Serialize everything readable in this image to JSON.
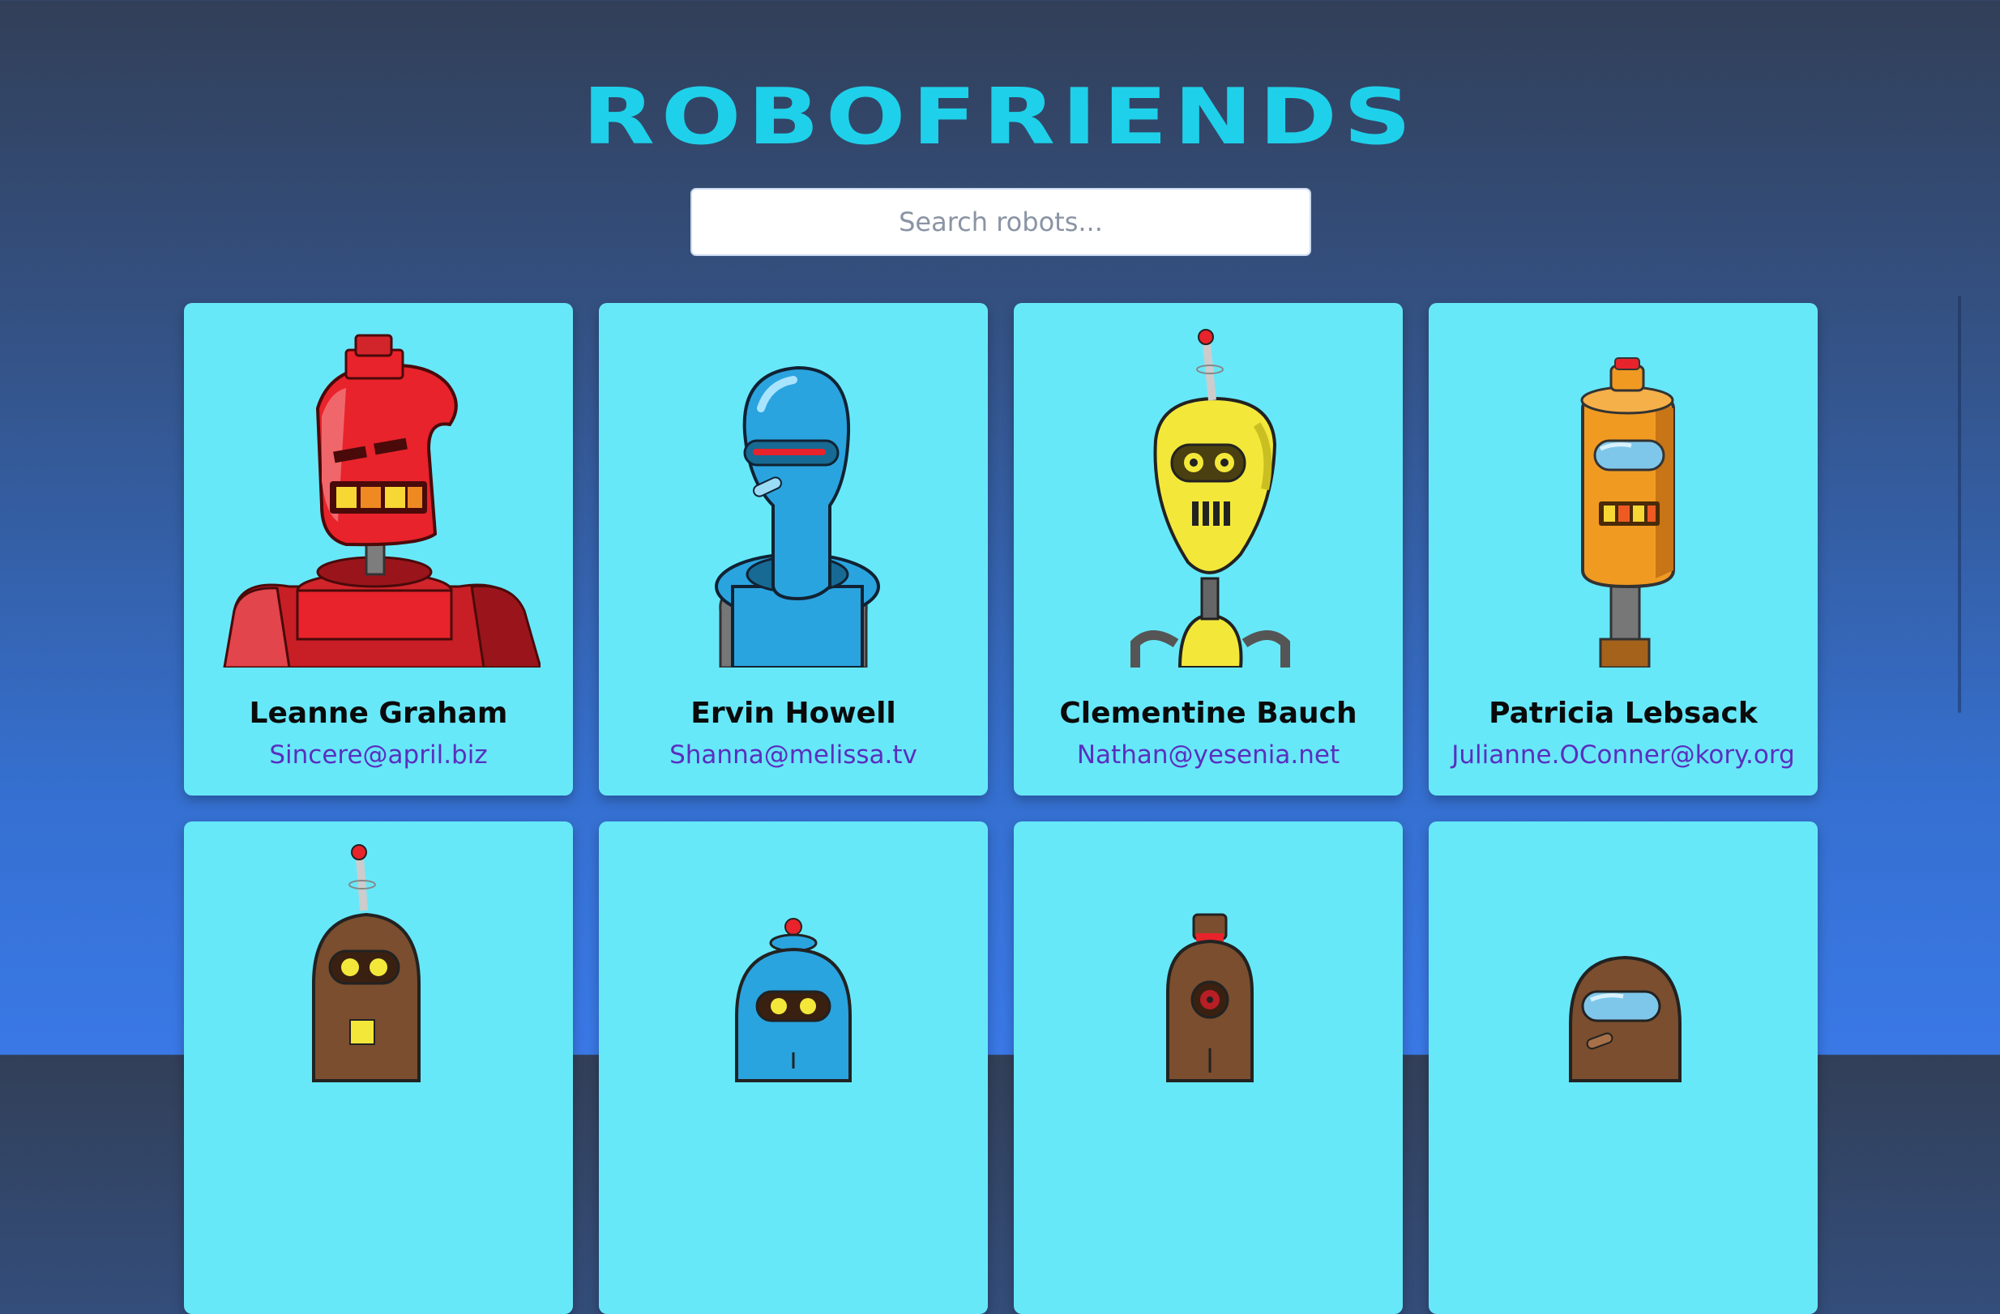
{
  "app": {
    "title": "ROBOFRIENDS"
  },
  "search": {
    "placeholder": "Search robots...",
    "value": ""
  },
  "robots": [
    {
      "name": "Leanne Graham",
      "email": "Sincere@april.biz",
      "color": "#e8232b",
      "avatar_icon": "red-robot-icon"
    },
    {
      "name": "Ervin Howell",
      "email": "Shanna@melissa.tv",
      "color": "#2aa4df",
      "avatar_icon": "blue-robot-icon"
    },
    {
      "name": "Clementine Bauch",
      "email": "Nathan@yesenia.net",
      "color": "#f3e83a",
      "avatar_icon": "yellow-robot-icon"
    },
    {
      "name": "Patricia Lebsack",
      "email": "Julianne.OConner@kory.org",
      "color": "#f09a22",
      "avatar_icon": "orange-robot-icon"
    },
    {
      "name": "",
      "email": "",
      "color": "#7a4e2e",
      "avatar_icon": "brown-robot-icon"
    },
    {
      "name": "",
      "email": "",
      "color": "#2aa4df",
      "avatar_icon": "blue-robot-icon"
    },
    {
      "name": "",
      "email": "",
      "color": "#7a4e2e",
      "avatar_icon": "brown-robot-icon"
    },
    {
      "name": "",
      "email": "",
      "color": "#7a4e2e",
      "avatar_icon": "brown-robot-icon"
    }
  ],
  "theme": {
    "title_color": "#1fd0ea",
    "card_color": "#67e8f9",
    "email_color": "#5a2fbf"
  }
}
